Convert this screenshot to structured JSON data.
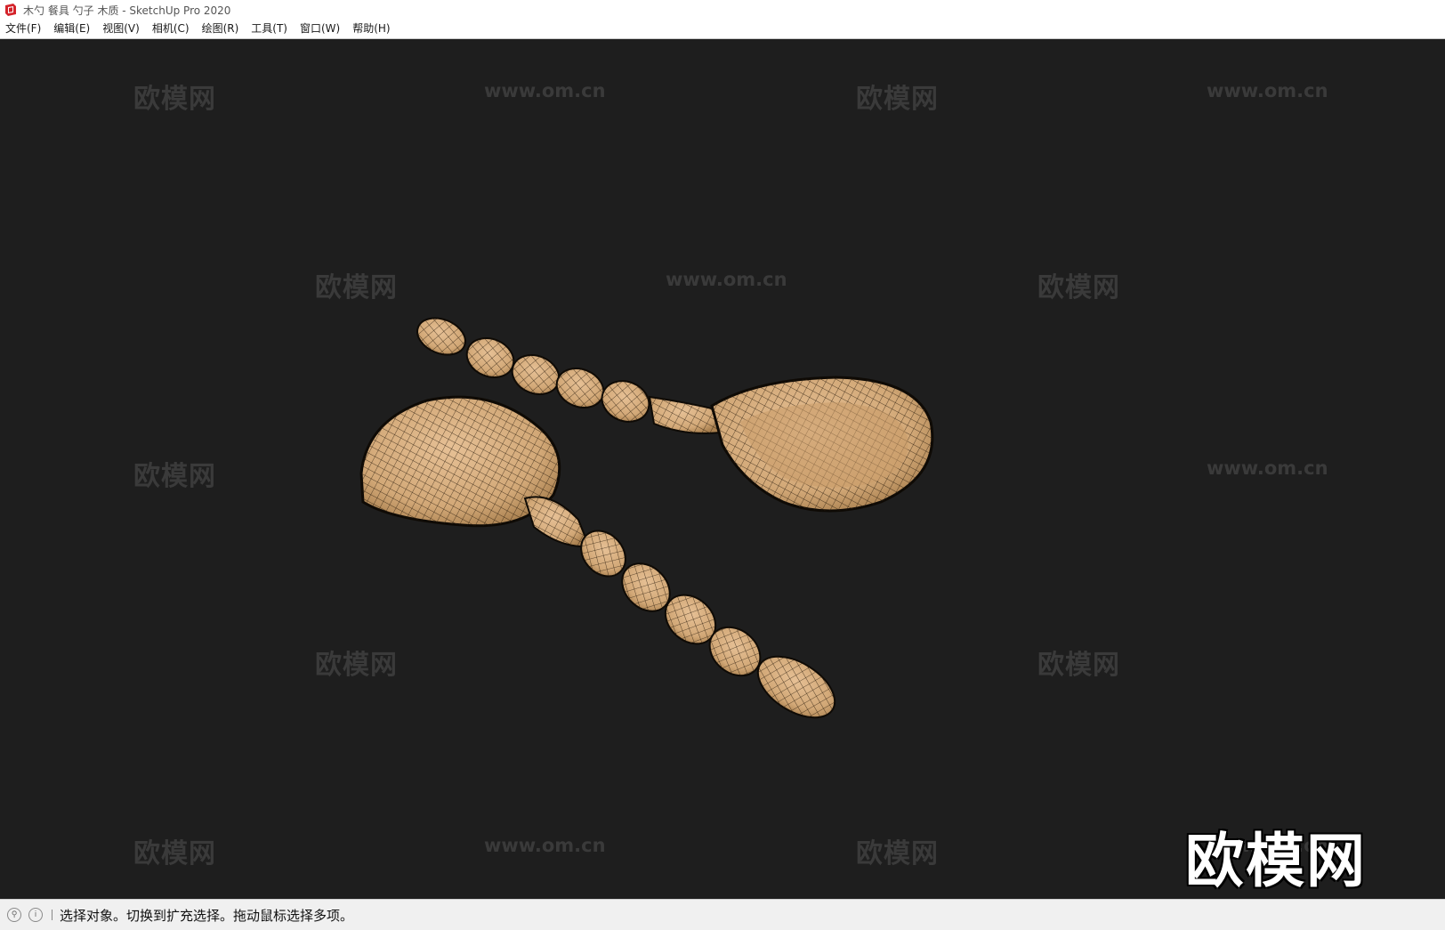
{
  "window": {
    "title": "木勺 餐具 勺子 木质 - SketchUp Pro 2020"
  },
  "menu": [
    {
      "id": "file",
      "label": "文件(F)"
    },
    {
      "id": "edit",
      "label": "编辑(E)"
    },
    {
      "id": "view",
      "label": "视图(V)"
    },
    {
      "id": "camera",
      "label": "相机(C)"
    },
    {
      "id": "draw",
      "label": "绘图(R)"
    },
    {
      "id": "tools",
      "label": "工具(T)"
    },
    {
      "id": "window",
      "label": "窗口(W)"
    },
    {
      "id": "help",
      "label": "帮助(H)"
    }
  ],
  "viewport": {
    "background": "#1e1e1e",
    "model_color": "#d8b183",
    "wireframe_color": "#1a1208"
  },
  "watermark": {
    "site_cn": "欧模网",
    "site_url": "www.om.cn",
    "brand": "欧模网"
  },
  "statusbar": {
    "message": "选择对象。切换到扩充选择。拖动鼠标选择多项。",
    "icons": [
      "geo-location-icon",
      "info-icon"
    ]
  }
}
